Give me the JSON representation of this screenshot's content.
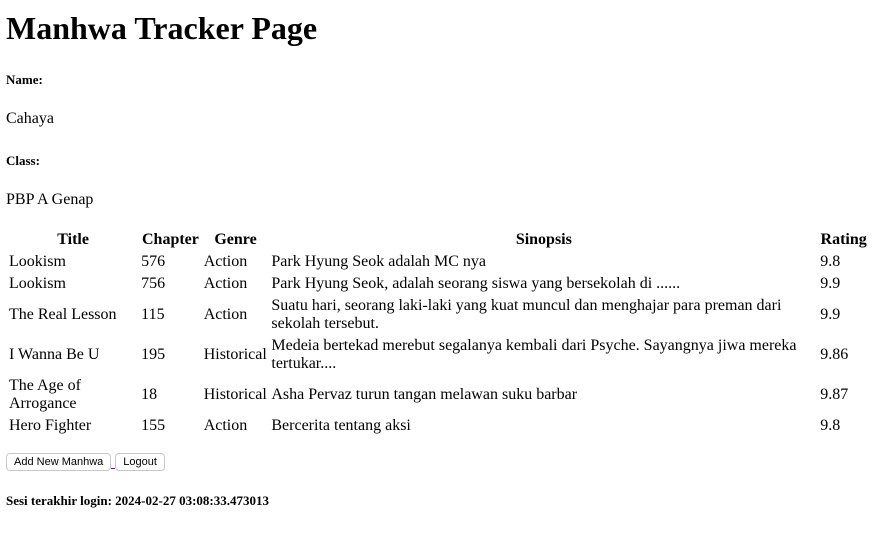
{
  "page": {
    "heading": "Manhwa Tracker Page"
  },
  "profile": {
    "name_label": "Name:",
    "name_value": "Cahaya",
    "class_label": "Class:",
    "class_value": "PBP A Genap"
  },
  "table": {
    "headers": [
      "Title",
      "Chapter",
      "Genre",
      "Sinopsis",
      "Rating"
    ],
    "rows": [
      {
        "title": "Lookism",
        "chapter": "576",
        "genre": "Action",
        "sinopsis": "Park Hyung Seok adalah MC nya",
        "rating": "9.8"
      },
      {
        "title": "Lookism",
        "chapter": "756",
        "genre": "Action",
        "sinopsis": "Park Hyung Seok, adalah seorang siswa yang bersekolah di ......",
        "rating": "9.9"
      },
      {
        "title": "The Real Lesson",
        "chapter": "115",
        "genre": "Action",
        "sinopsis": "Suatu hari, seorang laki-laki yang kuat muncul dan menghajar para preman dari sekolah tersebut.",
        "rating": "9.9"
      },
      {
        "title": "I Wanna Be U",
        "chapter": "195",
        "genre": "Historical",
        "sinopsis": "Medeia bertekad merebut segalanya kembali dari Psyche. Sayangnya jiwa mereka tertukar....",
        "rating": "9.86"
      },
      {
        "title": "The Age of Arrogance",
        "chapter": "18",
        "genre": "Historical",
        "sinopsis": "Asha Pervaz turun tangan melawan suku barbar",
        "rating": "9.87"
      },
      {
        "title": "Hero Fighter",
        "chapter": "155",
        "genre": "Action",
        "sinopsis": "Bercerita tentang aksi",
        "rating": "9.8"
      }
    ]
  },
  "actions": {
    "add_label": "Add New Manhwa",
    "logout_label": "Logout"
  },
  "footer": {
    "last_login": "Sesi terakhir login: 2024-02-27 03:08:33.473013"
  }
}
